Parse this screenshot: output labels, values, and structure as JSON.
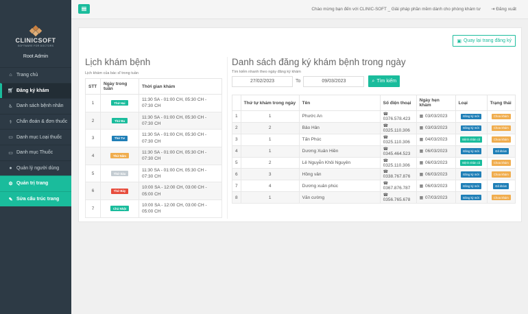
{
  "app": {
    "logo_text": "CLINICSOFT",
    "logo_sub": "SOFTWARE FOR DOCTORS",
    "user_name": "Root Admin"
  },
  "topbar": {
    "welcome": "Chào mừng bạn đến với CLINIC-SOFT _ Giải pháp phần mềm dành cho phòng khám tư",
    "logout": "Đăng xuất"
  },
  "sidebar": {
    "items": [
      {
        "label": "Trang chủ",
        "icon": "home-icon"
      },
      {
        "label": "Đăng ký khám",
        "icon": "cart-icon"
      },
      {
        "label": "Danh sách bệnh nhân",
        "icon": "wheelchair-icon"
      },
      {
        "label": "Chẩn đoán & đơn thuốc",
        "icon": "stethoscope-icon"
      },
      {
        "label": "Danh mục Loại thuốc",
        "icon": "folder-icon"
      },
      {
        "label": "Danh mục Thuốc",
        "icon": "folder-icon"
      },
      {
        "label": "Quản lý người dùng",
        "icon": "user-icon"
      },
      {
        "label": "Quản trị trang",
        "icon": "gear-icon"
      },
      {
        "label": "Sửa cấu trúc trang",
        "icon": "wrench-icon"
      }
    ]
  },
  "panel": {
    "back_button": "Quay lại trang đăng ký"
  },
  "schedule": {
    "title": "Lịch khám bệnh",
    "subtitle": "Lịch khám của bác sĩ trong tuần",
    "headers": [
      "STT",
      "Ngày trong tuần",
      "Thời gian khám"
    ],
    "rows": [
      {
        "stt": "1",
        "day": "Thứ Hai",
        "color": "#1abc9c",
        "time": "11:30 SA - 01:00 CH, 05:30 CH - 07:30 CH"
      },
      {
        "stt": "2",
        "day": "Thứ Ba",
        "color": "#1abc9c",
        "time": "11:30 SA - 01:00 CH, 05:30 CH - 07:30 CH"
      },
      {
        "stt": "3",
        "day": "Thứ Tư",
        "color": "#1f7fb7",
        "time": "11:30 SA - 01:00 CH, 05:30 CH - 07:30 CH"
      },
      {
        "stt": "4",
        "day": "Thứ Năm",
        "color": "#f0ad4e",
        "time": "11:30 SA - 01:00 CH, 05:30 CH - 07:30 CH"
      },
      {
        "stt": "5",
        "day": "Thứ Sáu",
        "color": "#c4ccd2",
        "time": "11:30 SA - 01:00 CH, 05:30 CH - 07:30 CH"
      },
      {
        "stt": "6",
        "day": "Thứ Bảy",
        "color": "#e74c3c",
        "time": "10:00 SA - 12:00 CH, 03:00 CH - 05:00 CH"
      },
      {
        "stt": "7",
        "day": "Chủ Nhật",
        "color": "#1abc9c",
        "time": "10:00 SA - 12:00 CH, 03:00 CH - 05:00 CH"
      }
    ]
  },
  "registrations": {
    "title": "Danh sách đăng ký khám bệnh trong ngày",
    "search_label": "Tìm kiếm nhanh theo ngày đăng ký khám",
    "date_from": "27/02/2023",
    "to_label": "To",
    "date_to": "09/03/2023",
    "search_button": "Tìm kiếm",
    "headers": [
      "",
      "Thứ tự khám trong ngày",
      "Tên",
      "Số điện thoại",
      "Ngày hẹn khám",
      "Loại",
      "Trạng thái"
    ],
    "rows": [
      {
        "idx": "1",
        "order": "1",
        "name": "Phước An",
        "phone": "0376.578.423",
        "date": "03/03/2023",
        "type": "Đăng ký mới",
        "type_kind": "new",
        "status": "Chưa khám",
        "status_kind": "wait"
      },
      {
        "idx": "2",
        "order": "2",
        "name": "Bảo Hân",
        "phone": "0325.110.306",
        "date": "03/03/2023",
        "type": "Đăng ký mới",
        "type_kind": "new",
        "status": "Chưa khám",
        "status_kind": "wait"
      },
      {
        "idx": "3",
        "order": "1",
        "name": "Tấn Phúc",
        "phone": "0325.110.306",
        "date": "04/03/2023",
        "type": "Bệnh nhân cũ",
        "type_kind": "old",
        "status": "Chưa khám",
        "status_kind": "wait"
      },
      {
        "idx": "4",
        "order": "1",
        "name": "Dương Xuân Hiền",
        "phone": "0345.464.523",
        "date": "06/03/2023",
        "type": "Đăng ký mới",
        "type_kind": "new",
        "status": "Đã khám",
        "status_kind": "done"
      },
      {
        "idx": "5",
        "order": "2",
        "name": "Lê Nguyễn Khôi Nguyên",
        "phone": "0325.110.306",
        "date": "06/03/2023",
        "type": "Bệnh nhân cũ",
        "type_kind": "old",
        "status": "Chưa khám",
        "status_kind": "wait"
      },
      {
        "idx": "6",
        "order": "3",
        "name": "Hồng vân",
        "phone": "0338.767.876",
        "date": "06/03/2023",
        "type": "Đăng ký mới",
        "type_kind": "new",
        "status": "Chưa khám",
        "status_kind": "wait"
      },
      {
        "idx": "7",
        "order": "4",
        "name": "Dương xuân phúc",
        "phone": "0367.876.787",
        "date": "06/03/2023",
        "type": "Đăng ký mới",
        "type_kind": "new",
        "status": "Đã khám",
        "status_kind": "done"
      },
      {
        "idx": "8",
        "order": "1",
        "name": "Văn cường",
        "phone": "0356.765.678",
        "date": "07/03/2023",
        "type": "Đăng ký mới",
        "type_kind": "new",
        "status": "Chưa khám",
        "status_kind": "wait"
      }
    ]
  }
}
